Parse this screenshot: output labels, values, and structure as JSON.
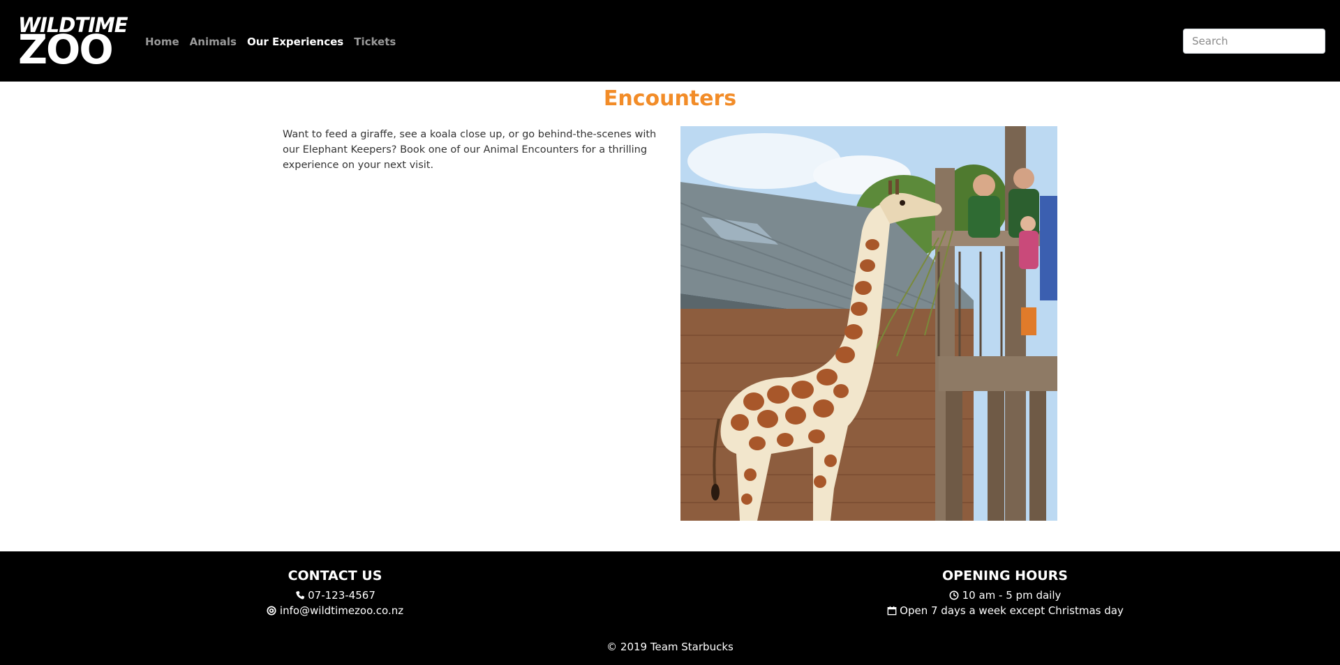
{
  "header": {
    "logo_top": "WILDTIME",
    "logo_bottom": "ZOO",
    "nav": [
      {
        "label": "Home"
      },
      {
        "label": "Animals"
      },
      {
        "label": "Our Experiences"
      },
      {
        "label": "Tickets"
      }
    ],
    "search_placeholder": "Search"
  },
  "main": {
    "title": "Encounters",
    "intro": "Want to feed a giraffe, see a koala close up, or go behind-the-scenes with our Elephant Keepers? Book one of our Animal Encounters for a thrilling experience on your next visit."
  },
  "footer": {
    "contact": {
      "heading": "CONTACT US",
      "phone": "07-123-4567",
      "email": "info@wildtimezoo.co.nz"
    },
    "hours": {
      "heading": "OPENING HOURS",
      "time": "10 am - 5 pm daily",
      "days": "Open 7 days a week except Christmas day"
    },
    "copyright": "© 2019 Team Starbucks"
  },
  "colors": {
    "accent": "#f28c28",
    "nav_bg": "#000000",
    "nav_inactive": "#9a9a9a",
    "nav_active": "#ffffff"
  }
}
